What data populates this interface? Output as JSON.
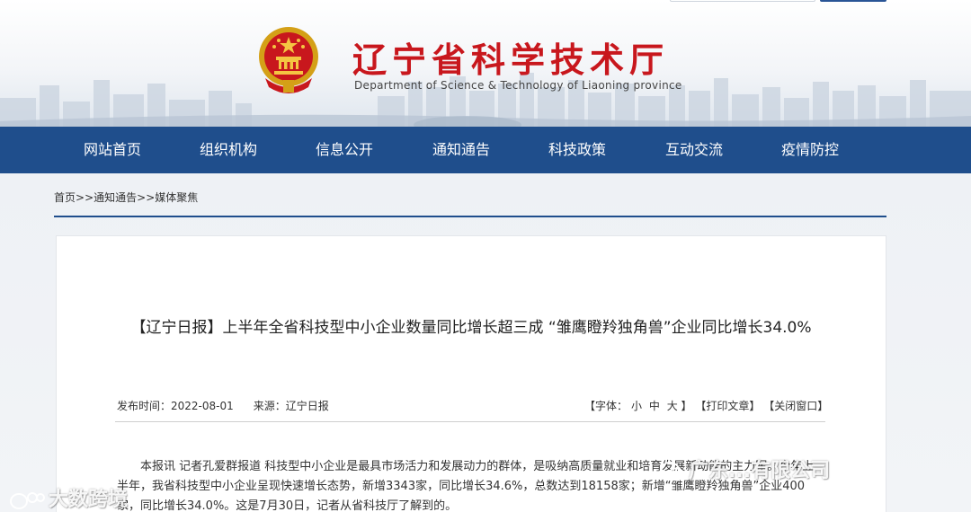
{
  "header": {
    "title": "辽宁省科学技术厅",
    "subtitle": "Department of Science & Technology of Liaoning province"
  },
  "nav": {
    "items": [
      {
        "label": "网站首页"
      },
      {
        "label": "组织机构"
      },
      {
        "label": "信息公开"
      },
      {
        "label": "通知通告"
      },
      {
        "label": "科技政策"
      },
      {
        "label": "互动交流"
      },
      {
        "label": "疫情防控"
      }
    ]
  },
  "breadcrumb": {
    "items": [
      "首页",
      "通知通告",
      "媒体聚焦"
    ],
    "separator": ">>"
  },
  "article": {
    "title": "【辽宁日报】上半年全省科技型中小企业数量同比增长超三成 “雏鹰瞪羚独角兽”企业同比增长34.0%",
    "date_label": "发布时间：",
    "date": "2022-08-01",
    "source_label": "来源：",
    "source": "辽宁日报",
    "font_open": "【字体：",
    "font_small": "小",
    "font_medium": "中",
    "font_large": "大",
    "font_close": "】",
    "print": "【打印文章】",
    "close_window": "【关闭窗口】",
    "body": "本报讯 记者孔爱群报道 科技型中小企业是最具市场活力和发展动力的群体，是吸纳高质量就业和培育发展新动能的主力军。今年上半年，我省科技型中小企业呈现快速增长态势，新增3343家，同比增长34.6%，总数达到18158家；新增“雏鹰瞪羚独角兽”企业400家，同比增长34.0%。这是7月30日，记者从省科技厅了解到的。"
  },
  "watermarks": {
    "right": "广东...有限公司",
    "left": "大数跨境"
  },
  "colors": {
    "nav_bg": "#1f4e8c",
    "title_red": "#c8171d",
    "divider_blue": "#1f4e8c"
  },
  "icons": [
    "national-emblem-icon",
    "wechat-icon",
    "weibo-icon"
  ]
}
